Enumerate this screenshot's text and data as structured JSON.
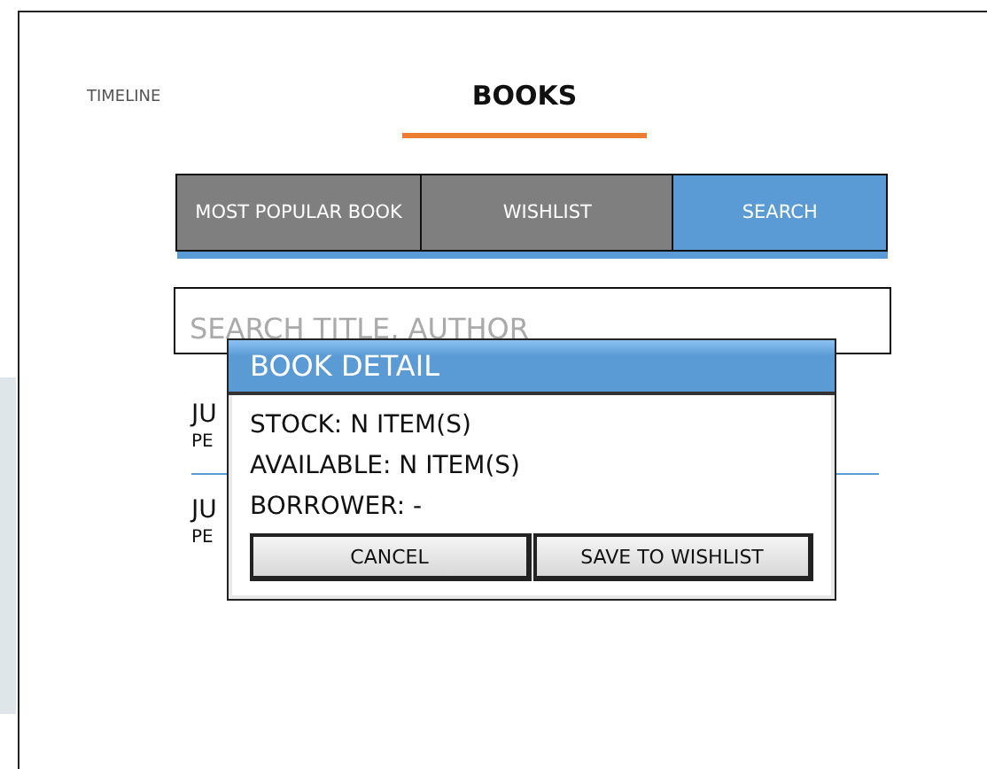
{
  "nav_tabs": [
    {
      "label": "TIMELINE",
      "selected": false
    },
    {
      "label": "BOOKS",
      "selected": true
    }
  ],
  "segments": [
    {
      "label": "MOST POPULAR BOOK",
      "selected": false
    },
    {
      "label": "WISHLIST",
      "selected": false
    },
    {
      "label": "SEARCH",
      "selected": true
    }
  ],
  "search": {
    "placeholder": "SEARCH TITLE, AUTHOR"
  },
  "results": [
    {
      "title": "JU",
      "subtitle": "PE"
    },
    {
      "title": "JU",
      "subtitle": "PE"
    }
  ],
  "dialog": {
    "title": "BOOK DETAIL",
    "lines": [
      "STOCK: N ITEM(S)",
      "AVAILABLE: N ITEM(S)",
      "BORROWER: -"
    ],
    "buttons": [
      "CANCEL",
      "SAVE TO WISHLIST"
    ]
  }
}
